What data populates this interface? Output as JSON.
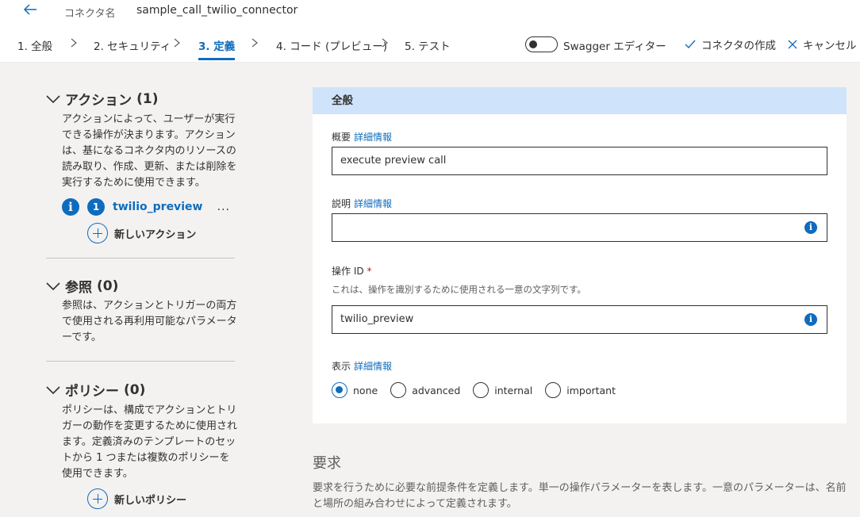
{
  "topbar": {
    "connector_label": "コネクタ名",
    "connector_value": "sample_call_twilio_connector"
  },
  "tabs": [
    {
      "label": "1. 全般"
    },
    {
      "label": "2. セキュリティ"
    },
    {
      "label": "3. 定義"
    },
    {
      "label": "4. コード (プレビュー)"
    },
    {
      "label": "5. テスト"
    }
  ],
  "toolbar": {
    "swagger_label": "Swagger エディター",
    "create_label": "コネクタの作成",
    "cancel_label": "キャンセル"
  },
  "left": {
    "actions": {
      "title": "アクション",
      "count": "(1)",
      "desc": "アクションによって、ユーザーが実行できる操作が決まります。アクションは、基になるコネクタ内のリソースの読み取り、作成、更新、または削除を実行するために使用できます。",
      "item_number": "1",
      "item_name": "twilio_preview",
      "more": "...",
      "new_label": "新しいアクション"
    },
    "references": {
      "title": "参照",
      "count": "(0)",
      "desc": "参照は、アクションとトリガーの両方で使用される再利用可能なパラメーターです。"
    },
    "policies": {
      "title": "ポリシー",
      "count": "(0)",
      "desc": "ポリシーは、構成でアクションとトリガーの動作を変更するために使用されます。定義済みのテンプレートのセットから 1 つまたは複数のポリシーを使用できます。",
      "new_label": "新しいポリシー"
    }
  },
  "card": {
    "header": "全般",
    "summary": {
      "label": "概要",
      "link": "詳細情報",
      "value": "execute preview call"
    },
    "description": {
      "label": "説明",
      "link": "詳細情報",
      "value": ""
    },
    "operation_id": {
      "label": "操作 ID",
      "required": "*",
      "help": "これは、操作を識別するために使用される一意の文字列です。",
      "value": "twilio_preview"
    },
    "visibility": {
      "label": "表示",
      "link": "詳細情報",
      "options": [
        "none",
        "advanced",
        "internal",
        "important"
      ],
      "selected": "none"
    }
  },
  "request": {
    "title": "要求",
    "desc": "要求を行うために必要な前提条件を定義します。単一の操作パラメーターを表します。一意のパラメーターは、名前と場所の組み合わせによって定義されます。"
  },
  "colors": {
    "accent": "#0f6cbd",
    "header_bg": "#cfe4fa",
    "page_bg": "#f3f2f1"
  }
}
